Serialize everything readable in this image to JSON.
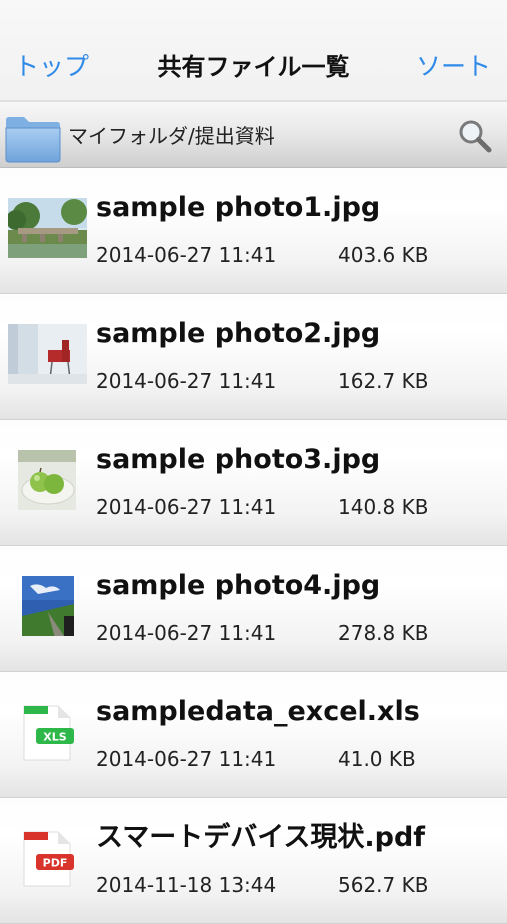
{
  "nav": {
    "back_label": "トップ",
    "title": "共有ファイル一覧",
    "sort_label": "ソート"
  },
  "pathbar": {
    "path": "マイフォルダ/提出資料",
    "folder_icon": "folder-icon",
    "search_icon": "search-icon"
  },
  "files": [
    {
      "name": "sample photo1.jpg",
      "date": "2014-06-27 11:41",
      "size": "403.6 KB",
      "thumb": "photo-landscape"
    },
    {
      "name": "sample photo2.jpg",
      "date": "2014-06-27 11:41",
      "size": "162.7 KB",
      "thumb": "photo-chair"
    },
    {
      "name": "sample photo3.jpg",
      "date": "2014-06-27 11:41",
      "size": "140.8 KB",
      "thumb": "photo-apples"
    },
    {
      "name": "sample photo4.jpg",
      "date": "2014-06-27 11:41",
      "size": "278.8 KB",
      "thumb": "photo-sky"
    },
    {
      "name": "sampledata_excel.xls",
      "date": "2014-06-27 11:41",
      "size": "41.0 KB",
      "thumb": "xls-icon",
      "badge": "XLS"
    },
    {
      "name": "スマートデバイス現状.pdf",
      "date": "2014-11-18 13:44",
      "size": "562.7 KB",
      "thumb": "pdf-icon",
      "badge": "PDF"
    }
  ],
  "colors": {
    "accent": "#2f8ae8",
    "xls": "#2fb84a",
    "pdf": "#d9342b"
  }
}
